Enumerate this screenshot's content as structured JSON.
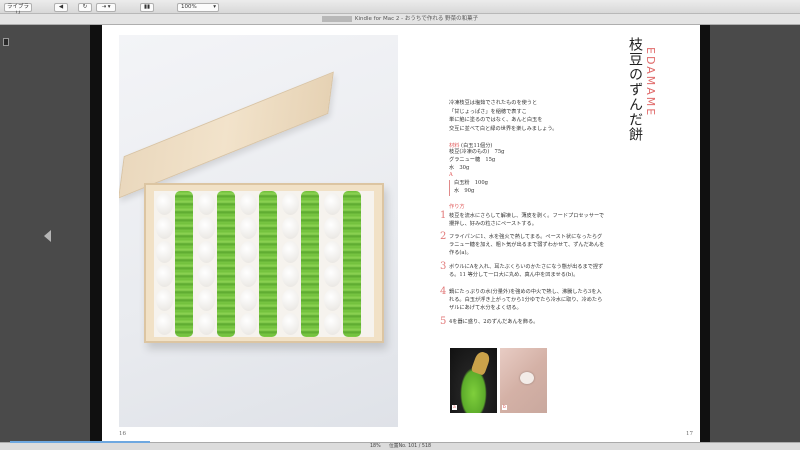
{
  "toolbar": {
    "library_label": "ライブラリ",
    "zoom_value": "100%"
  },
  "window": {
    "title": "Kindle for Mac 2 - おうちで作れる 野菜の和菓子"
  },
  "book": {
    "left_page_number": "16",
    "right_page_number": "17",
    "recipe_title": "枝豆のずんだ餅",
    "recipe_title_roman": "EDAMAME",
    "intro_lines": [
      "冷凍枝豆は塩茹でされたものを使うと",
      "「甘じょっぱさ」を稲穂で表すこ",
      "単に餡に塗るのではなく、あんと白玉を",
      "交互に並べて白と緑の世界を楽しみましょう。"
    ],
    "ingredients_heading": "材料",
    "ingredients_note": "(白玉11個分)",
    "ingredients": [
      "枝豆(冷凍のもの)　75g",
      "グラニュー糖　15g",
      "水　30g"
    ],
    "ingredients_group_label": "A",
    "ingredients_group": [
      "白玉粉　100g",
      "水　90g"
    ],
    "method_heading": "作り方",
    "steps": [
      {
        "num": "1",
        "lines": [
          "枝豆を流水にさらして解凍し、薄皮を剥く。フードプロセッサーで",
          "攪拌し、好みの粒さにペーストする。"
        ]
      },
      {
        "num": "2",
        "lines": [
          "フライパンに1、水を強火で熱してまる。ペースト状になったらグ",
          "ラニュー糖を加え、粗ト気が出るまで弱ずわかせて、ずんだあんを",
          "作る(a)。"
        ]
      },
      {
        "num": "3",
        "lines": [
          "ボウルにAを入れ、耳たぶくらいのかたさになう態が出るまで捏ず",
          "る。11 等分して一口大に丸め、真ん中を凹ませる(b)。"
        ]
      },
      {
        "num": "4",
        "lines": [
          "鍋にたっぷりの水(分量外)を強めの中火で熱し、沸騰したら3を入",
          "れる。白玉が浮き上がってから1分ゆでたら冷水に取り、冷めたら",
          "ザルにあげて水分をよく切る。"
        ]
      },
      {
        "num": "5",
        "lines": [
          "4を器に盛り、2のずんだあんを飾る。"
        ]
      }
    ],
    "thumb_labels": [
      "a",
      "b"
    ]
  },
  "status": {
    "percent": "18%",
    "location": "位置No. 101 / 518"
  },
  "progress_fraction": 0.18
}
